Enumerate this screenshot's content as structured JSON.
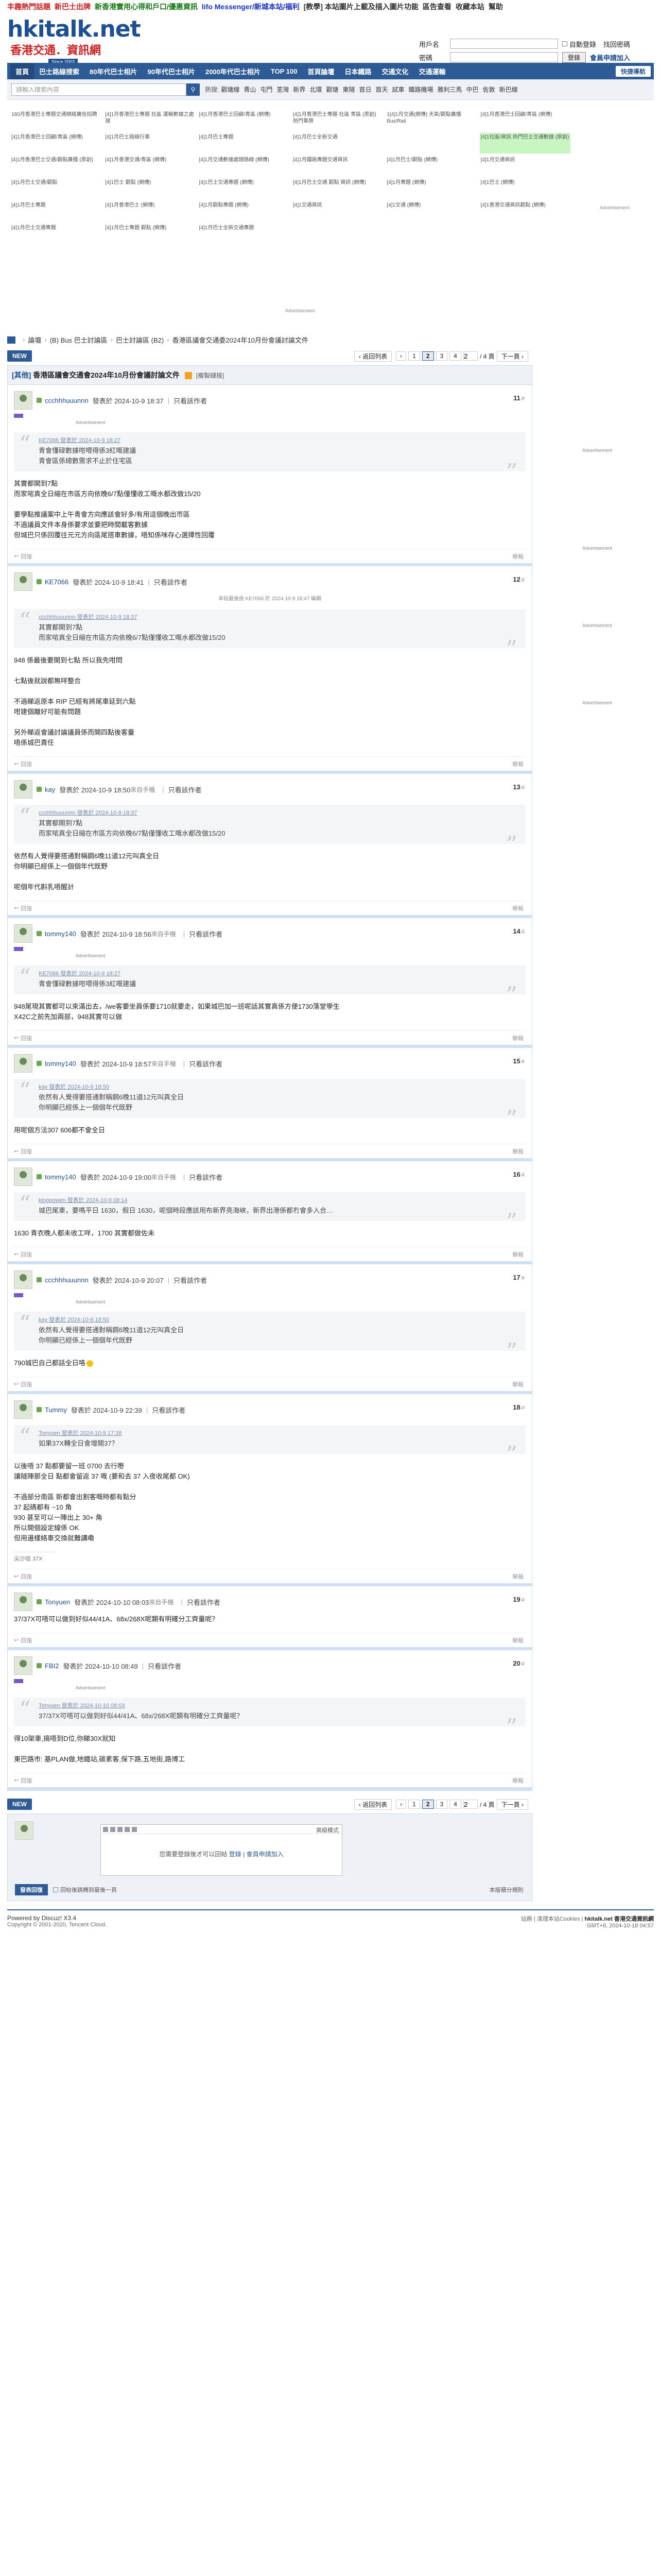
{
  "topbar": {
    "links": [
      {
        "text": "丰趣熱門話題",
        "color": "#cc2222"
      },
      {
        "text": "新巴士出牌",
        "color": "#cc2222"
      },
      {
        "text": "新香港實用心得和戶口/優惠資訊",
        "color": "#1a7a1a"
      },
      {
        "text": "lifo Messenger/新城本站/福利",
        "color": "#1a33cc"
      },
      {
        "text": "[教學] 本站圖片上載及插入圖片功能",
        "color": "#333333"
      },
      {
        "text": "區告查看",
        "color": "#333333"
      },
      {
        "text": "收藏本站",
        "color": "#333333"
      },
      {
        "text": "幫助",
        "color": "#333333"
      }
    ]
  },
  "header": {
    "logo": "hkitalk.net",
    "logo_sub": "香港交通．資訊網",
    "since": "Since 2003",
    "login": {
      "username_label": "用戶名",
      "password_label": "密碼",
      "auto_login": "自動登錄",
      "forgot": "找回密碼",
      "login_button": "登錄",
      "register": "會員申請加入"
    }
  },
  "nav": {
    "items": [
      "首頁",
      "巴士路線搜索",
      "80年代巴士相片",
      "90年代巴士相片",
      "2000年代巴士相片",
      "TOP 100",
      "首頁論壇",
      "日本鐵路",
      "交通文化",
      "交通運輸"
    ],
    "quick": "快捷導航"
  },
  "search": {
    "placeholder": "請輸入搜索內容",
    "hot_label": "熱搜:",
    "keywords": [
      "觀塘線",
      "青山",
      "屯門",
      "荃灣",
      "新界",
      "北環",
      "觀塘",
      "東隧",
      "首日",
      "首天",
      "試車",
      "鐵路機場",
      "雅利三馬",
      "中巴",
      "佐敦",
      "新巴線"
    ]
  },
  "ad_links": [
    {
      "text": "180月香港巴士專題交通網絡廣告招聘",
      "hl": false
    },
    {
      "text": "[4]1月香港巴士專題 社區 運輸數據之處理",
      "hl": false
    },
    {
      "text": "[4]1月香港巴士回顧/青區 (網傳)",
      "hl": false
    },
    {
      "text": "[4]1月香港巴士專題 社區 青區 (原創) 熱門車牌",
      "hl": false
    },
    {
      "text": "1[4]1月交通(網傳) 天氣/觀點廣播 Bus/Rail",
      "hl": false
    },
    {
      "text": "[4]1月香港巴士回顧/青區 (網傳)",
      "hl": false
    },
    {
      "text": "[4]1月香港巴士回顧/青區 (網傳)",
      "hl": false
    },
    {
      "text": "[4]1月巴士路線行車",
      "hl": false
    },
    {
      "text": "[4]1月巴士專題",
      "hl": false
    },
    {
      "text": "[4]1月巴士全新交通",
      "hl": false
    },
    {
      "text": "",
      "hl": false
    },
    {
      "text": "[4]1社區/資訊 熱門巴士交通數據 (原創)",
      "hl": true
    },
    {
      "text": "[4]1月香港巴士交通/觀點廣播 (原創)",
      "hl": false
    },
    {
      "text": "[4]1月香港交通/青區 (網傳)",
      "hl": false
    },
    {
      "text": "[4]1月交通數據處理路線 (網傳)",
      "hl": false
    },
    {
      "text": "[4]1月鐵路專題交通資訊",
      "hl": false
    },
    {
      "text": "[4]1月巴士/觀點 (網傳)",
      "hl": false
    },
    {
      "text": "[4]1月交通資訊",
      "hl": false
    },
    {
      "text": "[4]1月巴士交通/觀點",
      "hl": false
    },
    {
      "text": "[4]1巴士 觀點 (網傳)",
      "hl": false
    },
    {
      "text": "[4]1巴士交通專題 (網傳)",
      "hl": false
    },
    {
      "text": "[4]1月巴士交通 觀點 資訊 (網傳)",
      "hl": false
    },
    {
      "text": "[4]1月專題 (網傳)",
      "hl": false
    },
    {
      "text": "[4]1巴士 (網傳)",
      "hl": false
    },
    {
      "text": "[4]1月巴士專題",
      "hl": false
    },
    {
      "text": "[4]1月香港巴士 (網傳)",
      "hl": false
    },
    {
      "text": "[4]1月觀點專題 (網傳)",
      "hl": false
    },
    {
      "text": "[4]1交通資訊",
      "hl": false
    },
    {
      "text": "[4]1交通 (網傳)",
      "hl": false
    },
    {
      "text": "[4]1香港交通資訊觀點 (網傳)",
      "hl": false
    },
    {
      "text": "[4]1月巴士交通專題",
      "hl": false
    },
    {
      "text": "[4]1月巴士專題 觀點 (網傳)",
      "hl": false
    },
    {
      "text": "[4]1月巴士全新交通專題",
      "hl": false
    },
    {
      "text": "",
      "hl": false
    },
    {
      "text": "",
      "hl": false
    },
    {
      "text": "",
      "hl": false
    }
  ],
  "ad_label": "Advertisement",
  "breadcrumb": [
    "論壇",
    "(B) Bus 巴士討論區",
    "巴士討論區 (B2)",
    "香港區議會交通委2024年10月份會議討論文件"
  ],
  "pager": {
    "new": "NEW",
    "back": "返回列表",
    "pages": [
      "1",
      "2",
      "3",
      "4"
    ],
    "current": "2",
    "total": "/ 4 頁",
    "next": "下一頁"
  },
  "thread": {
    "tag": "[其他]",
    "title": "香港區議會交通會2024年10月份會議討論文件",
    "copy": "[複製鏈接]"
  },
  "posts": [
    {
      "user": "ccchhhuuunnn",
      "time": "發表於 2024-10-9 18:37",
      "via": "",
      "floor": "11",
      "badge": true,
      "ad": true,
      "quote_author": "KE7066 發表於 2024-10-9 18:27",
      "quote_lines": [
        "青會懂碌數據咁喂得係3紅嘅建議",
        "",
        "青會區係總數需求不止於住宅區"
      ],
      "lines": [
        "其實都開到7點",
        "而家啱真全日縮在市區方向依晚6/7點僅懂收工嘅水都改做15/20",
        "",
        "要學點推議案中上午青會方向應該會好多/有用這個晚出帀區",
        "不過議員文件本身係要求並要把時間載客數據",
        "但城巴只係回覆往元元方向區尾搭車數據，唔知係咪存心選擇性回覆"
      ],
      "sig": ""
    },
    {
      "user": "KE7066",
      "time": "發表於 2024-10-9 18:41",
      "via": "",
      "floor": "12",
      "badge": false,
      "ad": false,
      "edit": "本帖最後由 KE7066 於 2024-10-9 18:47 編輯",
      "quote_author": "ccchhhuuunnn 發表於 2024-10-9 18:37",
      "quote_lines": [
        "其實都開到7點",
        "而家啱真全日縮在市區方向依晚6/7點僅懂收工嘅水都改做15/20"
      ],
      "lines": [
        "948 係最後要開到七點 所以我先咁問",
        "",
        "七點後就說都無咩整合",
        "",
        "不過睇返原本 RIP 已經有將尾車延到六點",
        "咁建個離好可能有問題",
        "",
        "另外睇返會議討論議員係而開四點後客量",
        "唔係城巴責任"
      ],
      "sig": ""
    },
    {
      "user": "kay",
      "time": "發表於 2024-10-9 18:50",
      "via": "來自手機",
      "floor": "13",
      "badge": false,
      "ad": false,
      "quote_author": "ccchhhuuunnn 發表於 2024-10-9 18:37",
      "quote_lines": [
        "其實都開到7點",
        "而家啱真全日縮在市區方向依晚6/7點僅懂收工嘅水都改做15/20"
      ],
      "lines": [
        "依然有人覺得要搭通對稱鋼6晚11道12元叫真全日",
        "你明顯已經係上一個個年代既野",
        "",
        "呢個年代斟乳唔醒計"
      ],
      "sig": ""
    },
    {
      "user": "tommy140",
      "time": "發表於 2024-10-9 18:56",
      "via": "來自手機",
      "floor": "14",
      "badge": true,
      "ad": true,
      "quote_author": "KE7066 發表於 2024-10-9 18:27",
      "quote_lines": [
        "青會懂碌數據咁喂得係3紅嘅建議"
      ],
      "lines": [
        "948尾現其實都可以來滿出去，/we客要坐員係要1710就要走，如果城巴加一班呢話其實真係方便1730落堂學生",
        "X42C之前先加兩部，948其實可以做"
      ],
      "sig": ""
    },
    {
      "user": "tommy140",
      "time": "發表於 2024-10-9 18:57",
      "via": "來自手機",
      "floor": "15",
      "badge": false,
      "ad": false,
      "quote_author": "kay 發表於 2024-10-9 18:50",
      "quote_lines": [
        "依然有人覺得要搭通對稱鋼6晚11道12元叫真全日",
        "你明顯已經係上一個個年代既野"
      ],
      "lines": [
        "用呢個方法307 606都不會全日"
      ],
      "sig": ""
    },
    {
      "user": "tommy140",
      "time": "發表於 2024-10-9 19:00",
      "via": "來自手機",
      "floor": "16",
      "badge": false,
      "ad": false,
      "quote_author": "kingpowen 發表於 2024-10-9 08:14",
      "quote_lines": [
        "城巴尾車，要嗎平日 1630，假日 1630，呢個時段應該用布新界亮海峽，新界出港係都冇會多入合…"
      ],
      "lines": [
        "1630 青衣晚人都未收工咩，1700 其實都做佐未"
      ],
      "sig": ""
    },
    {
      "user": "ccchhhuuunnn",
      "time": "發表於 2024-10-9 20:07",
      "via": "",
      "floor": "17",
      "badge": true,
      "ad": true,
      "quote_author": "kay 發表於 2024-10-9 18:50",
      "quote_lines": [
        "依然有人覺得要搭通對稱鋼6晚11道12元叫真全日",
        "你明顯已經係上一個個年代既野"
      ],
      "lines": [
        "790城巴自己都話全日咯"
      ],
      "smiley": true,
      "sig": ""
    },
    {
      "user": "Tummy",
      "time": "發表於 2024-10-9 22:39",
      "via": "",
      "floor": "18",
      "badge": false,
      "ad": false,
      "quote_author": "Tonyuen 發表於 2024-10-9 17:38",
      "quote_lines": [
        "如果37X轉全日會增開37？"
      ],
      "lines": [
        "以後唔 37 點都要留一班 0700 去行嘢",
        "讓隧陣那全日 點都會留返 37 嘅 (要和去 37 入夜收尾都 OK)",
        "",
        "不過部分南區 新都會出割客嘅時都有點分",
        "37 起碼都有 ~10 角",
        "930 甚至可以一陣出上 30+ 角",
        "所以開個設定線係 OK",
        "但用邊樣絡車交換就難講嘞"
      ],
      "sig": "尖沙咀 37X"
    },
    {
      "user": "Tonyuen",
      "time": "發表於 2024-10-10 08:03",
      "via": "來自手機",
      "floor": "19",
      "badge": false,
      "ad": false,
      "quote_author": "",
      "quote_lines": [],
      "lines": [
        "37/37X可唔可以做到好似44/41A、68x/268X呢類有明確分工齊量呢？"
      ],
      "sig": ""
    },
    {
      "user": "FBI2",
      "time": "發表於 2024-10-10 08:49",
      "via": "",
      "floor": "20",
      "badge": true,
      "ad": true,
      "quote_author": "Tonyuen 發表於 2024-10-10 08:03",
      "quote_lines": [
        "37/37X可唔可以做到好似44/41A、68x/268X呢類有明確分工齊量呢？"
      ],
      "lines": [
        "得10架車,搞唔到D位,你睇30X就知",
        "",
        "東巴路市: 基PLAN做,地鐵站,碳素客,保下路,五地街,路博工"
      ],
      "sig": ""
    }
  ],
  "footline": {
    "reply": "回復",
    "report": "舉報"
  },
  "editor": {
    "mode": "高級模式",
    "msg_prefix": "您需要登錄後才可以回帖",
    "login": "登錄",
    "sep": "|",
    "register": "會員申請加入",
    "reply_button": "發表回復",
    "notify": "回帖後跳轉到最後一頁",
    "rules": "本版積分規則"
  },
  "footer": {
    "powered": "Powered by Discuz! X3.4",
    "copyright": "Copyright © 2001-2020, Tencent Cloud.",
    "right_links": "站務 | 清理本站Cookies |",
    "site": "hkitalk.net 香港交通資訊網",
    "time": "GMT+8, 2024-10-18 04:57"
  },
  "colors": {
    "brand": "#2c5b95",
    "quote_bg": "#f4f5f7",
    "post_sep": "#cfe0f5"
  }
}
